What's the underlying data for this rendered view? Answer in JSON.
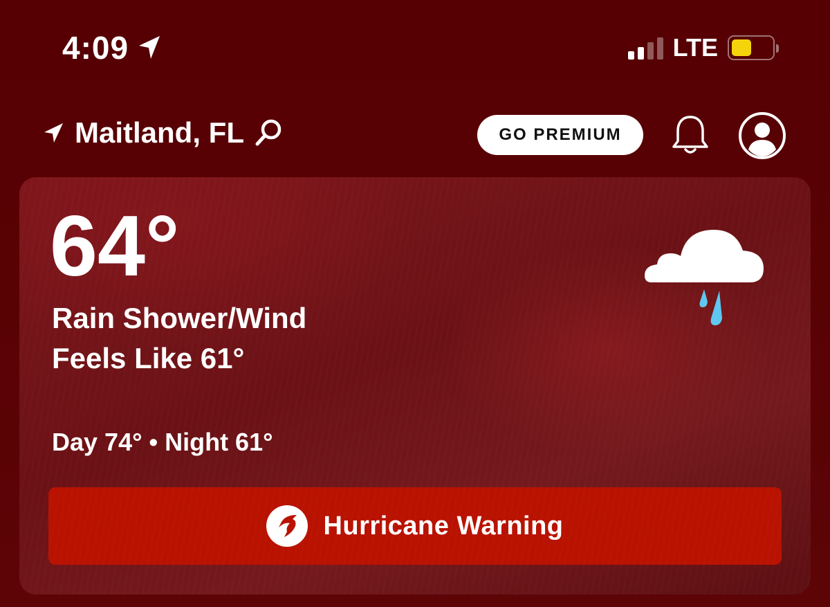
{
  "status_bar": {
    "time": "4:09",
    "network": "LTE",
    "battery_level": 0.5,
    "signal_bars_active": 2,
    "signal_bars_total": 4,
    "battery_color": "#f6d40c"
  },
  "header": {
    "location": "Maitland, FL",
    "premium_label": "GO PREMIUM"
  },
  "current": {
    "temperature": "64°",
    "condition": "Rain Shower/Wind",
    "feels_like": "Feels Like 61°",
    "day_night": "Day 74° • Night 61°",
    "icon": "cloud-rain-icon"
  },
  "alert": {
    "label": "Hurricane Warning",
    "icon": "hurricane-icon",
    "color": "#b91200"
  },
  "colors": {
    "background": "#520003",
    "rain_drop": "#5ec8f0"
  }
}
